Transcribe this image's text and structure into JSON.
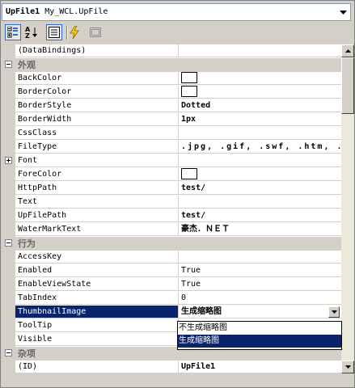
{
  "object_selector": {
    "bold_name": "UpFile1",
    "type_name": "My_WCL.UpFile"
  },
  "toolbar": {
    "buttons": [
      {
        "icon": "categorized-icon",
        "pressed": true
      },
      {
        "icon": "alphabetical-icon",
        "pressed": false
      },
      {
        "icon": "properties-icon",
        "pressed": true
      },
      {
        "icon": "events-icon",
        "pressed": false
      },
      {
        "icon": "property-pages-icon",
        "pressed": false
      }
    ]
  },
  "grid": {
    "rows": [
      {
        "kind": "prop",
        "name": "(DataBindings)",
        "value": ""
      },
      {
        "kind": "cat",
        "name": "外观"
      },
      {
        "kind": "prop",
        "name": "BackColor",
        "value": "",
        "swatch": "#ffffff"
      },
      {
        "kind": "prop",
        "name": "BorderColor",
        "value": "",
        "swatch": "#ffffff"
      },
      {
        "kind": "prop",
        "name": "BorderStyle",
        "value": "Dotted",
        "bold": true
      },
      {
        "kind": "prop",
        "name": "BorderWidth",
        "value": "1px",
        "bold": true
      },
      {
        "kind": "prop",
        "name": "CssClass",
        "value": ""
      },
      {
        "kind": "prop",
        "name": "FileType",
        "value": ".jpg, .gif, .swf, .htm, .js,",
        "bold": true,
        "wide": true
      },
      {
        "kind": "prop",
        "name": "Font",
        "value": "",
        "expand": true
      },
      {
        "kind": "prop",
        "name": "ForeColor",
        "value": "",
        "swatch": "#ffffff"
      },
      {
        "kind": "prop",
        "name": "HttpPath",
        "value": "test/",
        "bold": true
      },
      {
        "kind": "prop",
        "name": "Text",
        "value": ""
      },
      {
        "kind": "prop",
        "name": "UpFilePath",
        "value": "test/",
        "bold": true
      },
      {
        "kind": "prop",
        "name": "WaterMarkText",
        "value": "豪杰．ＮＥＴ",
        "bold": true,
        "cjk": true
      },
      {
        "kind": "cat",
        "name": "行为"
      },
      {
        "kind": "prop",
        "name": "AccessKey",
        "value": ""
      },
      {
        "kind": "prop",
        "name": "Enabled",
        "value": "True"
      },
      {
        "kind": "prop",
        "name": "EnableViewState",
        "value": "True"
      },
      {
        "kind": "prop",
        "name": "TabIndex",
        "value": "0"
      },
      {
        "kind": "prop",
        "name": "ThumbnailImage",
        "value": "生成缩略图",
        "selected": true,
        "dropdown": true,
        "bold": true,
        "cjk": true
      },
      {
        "kind": "prop",
        "name": "ToolTip",
        "value": ""
      },
      {
        "kind": "prop",
        "name": "Visible",
        "value": ""
      },
      {
        "kind": "cat",
        "name": "杂项"
      },
      {
        "kind": "prop",
        "name": "(ID)",
        "value": "UpFile1",
        "bold": true
      }
    ]
  },
  "dropdown": {
    "options": [
      "不生成缩略图",
      "生成缩略图"
    ],
    "selected_index": 1
  }
}
